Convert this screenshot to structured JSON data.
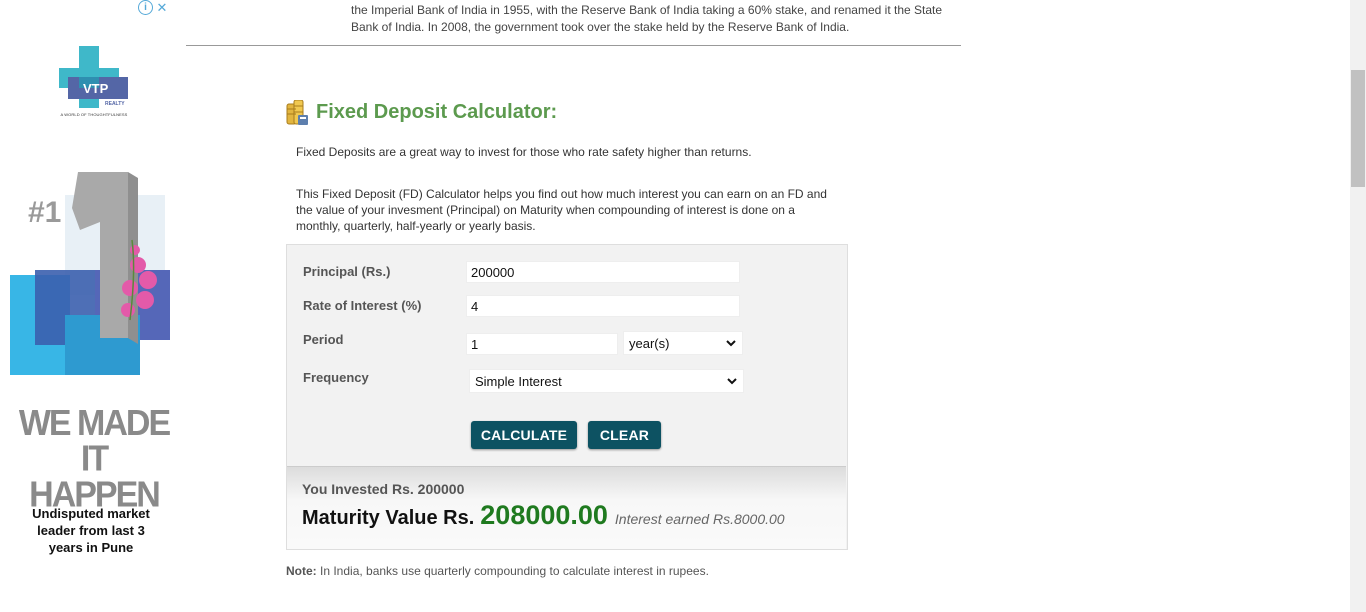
{
  "ad": {
    "brand": "VTP",
    "brand_sub": "REALTY",
    "tagline": "A WORLD OF THOUGHTFULNESS",
    "badge": "#1",
    "headline": "WE MADE IT HAPPEN",
    "subtext": "Undisputed market leader from last 3 years in Pune",
    "adchoices_icon": "info-icon",
    "close_icon": "close-icon"
  },
  "intro": {
    "text": "the Imperial Bank of India in 1955, with the Reserve Bank of India taking a 60% stake, and renamed it the State Bank of India. In 2008, the government took over the stake held by the Reserve Bank of India."
  },
  "calculator": {
    "title": "Fixed Deposit Calculator:",
    "description1": "Fixed Deposits are a great way to invest for those who rate safety higher than returns.",
    "description2": "This Fixed Deposit (FD) Calculator helps you find out how much interest you can earn on an FD and the value of your invesment (Principal) on Maturity when compounding of interest is done on a monthly, quarterly, half-yearly or yearly basis.",
    "fields": {
      "principal_label": "Principal (Rs.)",
      "principal_value": "200000",
      "rate_label": "Rate of Interest (%)",
      "rate_value": "4",
      "period_label": "Period",
      "period_value": "1",
      "period_unit": "year(s)",
      "frequency_label": "Frequency",
      "frequency_value": "Simple Interest"
    },
    "buttons": {
      "calculate": "CALCULATE",
      "clear": "CLEAR"
    },
    "result": {
      "invested": "You Invested Rs. 200000",
      "maturity_label": "Maturity Value Rs.",
      "maturity_value": "208000.00",
      "interest": "Interest earned Rs.8000.00"
    },
    "note_label": "Note:",
    "note_text": " In India, banks use quarterly compounding to calculate interest in rupees."
  },
  "colors": {
    "title_green": "#5c9a4e",
    "button_teal": "#0d5262",
    "maturity_green": "#1f7a1f"
  }
}
